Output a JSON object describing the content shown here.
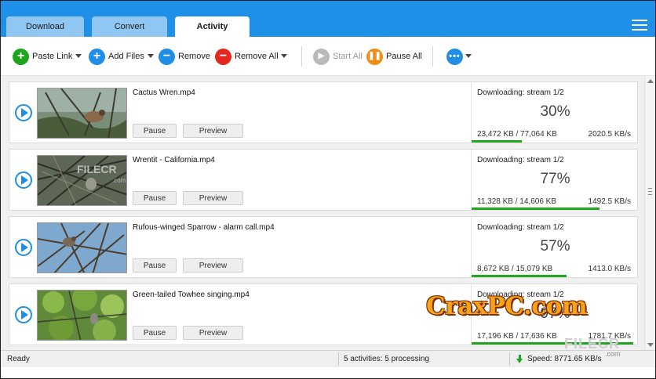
{
  "tabs": [
    {
      "label": "Download",
      "active": false
    },
    {
      "label": "Convert",
      "active": false
    },
    {
      "label": "Activity",
      "active": true
    }
  ],
  "toolbar": {
    "paste_link": "Paste Link",
    "add_files": "Add Files",
    "remove": "Remove",
    "remove_all": "Remove All",
    "start_all": "Start All",
    "pause_all": "Pause All"
  },
  "downloads": [
    {
      "filename": "Cactus Wren.mp4",
      "status": "Downloading: stream 1/2",
      "percent": "30%",
      "progress": 0.3,
      "sizes": "23,472 KB / 77,064 KB",
      "speed": "2020.5 KB/s",
      "pause_label": "Pause",
      "preview_label": "Preview"
    },
    {
      "filename": "Wrentit - California.mp4",
      "status": "Downloading: stream 1/2",
      "percent": "77%",
      "progress": 0.77,
      "sizes": "11,328 KB / 14,606 KB",
      "speed": "1492.5 KB/s",
      "pause_label": "Pause",
      "preview_label": "Preview"
    },
    {
      "filename": "Rufous-winged Sparrow - alarm call.mp4",
      "status": "Downloading: stream 1/2",
      "percent": "57%",
      "progress": 0.57,
      "sizes": "8,672 KB / 15,079 KB",
      "speed": "1413.0 KB/s",
      "pause_label": "Pause",
      "preview_label": "Preview"
    },
    {
      "filename": "Green-tailed Towhee singing.mp4",
      "status": "Downloading: stream 1/2",
      "percent": "97%",
      "progress": 0.97,
      "sizes": "17,196 KB / 17,636 KB",
      "speed": "1781.7 KB/s",
      "pause_label": "Pause",
      "preview_label": "Preview"
    }
  ],
  "statusbar": {
    "state": "Ready",
    "activities": "5 activities: 5 processing",
    "speed": "Speed: 8771.65 KB/s"
  },
  "watermarks": {
    "crax": "CraxPC.com",
    "filecr": "FILECR",
    "filecr_tld": ".com"
  },
  "colors": {
    "accent": "#1e90e8",
    "progress": "#20a820",
    "add": "#1ea51e",
    "remove_all": "#e4281e",
    "pause_all": "#f28c18"
  }
}
